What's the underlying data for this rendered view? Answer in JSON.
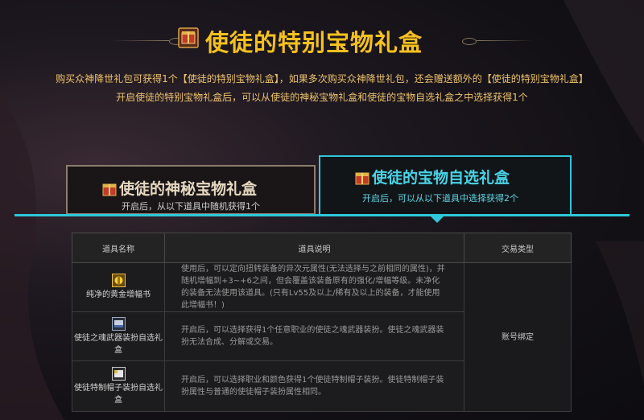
{
  "header": {
    "title": "使徒的特别宝物礼盒",
    "desc_line1": "购买众神降世礼包可获得1个【使徒的特别宝物礼盒】，如果多次购买众神降世礼包，还会赠送额外的【使徒的特别宝物礼盒】",
    "desc_line2": "开启使徒的特别宝物礼盒后，可以从使徒的神秘宝物礼盒和使徒的宝物自选礼盒之中选择获得1个"
  },
  "tabs": [
    {
      "title": "使徒的神秘宝物礼盒",
      "subtitle": "开启后，从以下道具中随机获得1个",
      "active": false
    },
    {
      "title": "使徒的宝物自选礼盒",
      "subtitle": "开启后，可以从以下道具中选择获得2个",
      "active": true
    }
  ],
  "table": {
    "headers": [
      "道具名称",
      "道具说明",
      "交易类型"
    ],
    "trade_type": "账号绑定",
    "rows": [
      {
        "name": "纯净的黄金增幅书",
        "icon": "gold-amplify-book-icon",
        "desc": "使用后，可以定向扭转装备的异次元属性(无法选择与之前相同的属性)，并随机增幅到+3~+6之间，但会覆盖该装备原有的强化/增幅等级。未净化的装备无法使用该道具。(只有Lv55及以上/稀有及以上的装备，才能使用此增幅书！)"
      },
      {
        "name": "使徒之魂武器装扮自选礼盒",
        "icon": "weapon-avatar-box-icon",
        "desc": "开启后，可以选择获得1个任意职业的使徒之魂武器装扮。使徒之魂武器装扮无法合成、分解或交易。"
      },
      {
        "name": "使徒特制帽子装扮自选礼盒",
        "icon": "hat-avatar-box-icon",
        "desc": "开启后，可以选择职业和颜色获得1个使徒特制帽子装扮。使徒特制帽子装扮属性与普通的使徒帽子装扮属性相同。"
      }
    ]
  },
  "colors": {
    "gold": "#f6c11e",
    "accent_cyan": "#2ec8da",
    "desc_gold": "#efc46a"
  }
}
